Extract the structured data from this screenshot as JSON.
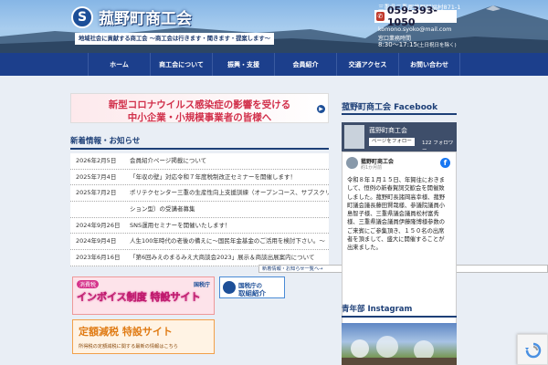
{
  "header": {
    "logo_mark": "S",
    "title": "菰野町商工会",
    "tagline": "地域社会に貢献する商工会 〜商工会は行きます・聞きます・提案します〜",
    "address": "三重県三重郡菰野町福村871-1",
    "phone": "059-393-1050",
    "email": "komono.syoko@mail.com",
    "hours_label": "窓口業務時間",
    "hours": "8:30〜17:15",
    "hours_note": "(土日祝日を除く)"
  },
  "nav": {
    "items": [
      "ホーム",
      "商工会について",
      "振興・支援",
      "会員紹介",
      "交通アクセス",
      "お問い合わせ"
    ]
  },
  "banner": {
    "line1": "新型コロナウイルス感染症の影響を受ける",
    "line2": "中小企業・小規模事業者の皆様へ"
  },
  "news": {
    "heading": "新着情報・お知らせ",
    "items": [
      {
        "date": "2026年2月5日",
        "title": "会員紹介ページ掲載について"
      },
      {
        "date": "2025年7月4日",
        "title": "「年収の壁」対応令和７年度税制改正セミナーを開催します！"
      },
      {
        "date": "2025年7月2日",
        "title": "ポリテクセンター三重の生産性向上支援訓練（オープンコース、サブスクリプ"
      },
      {
        "date": "",
        "title": "ション型）の受講者募集"
      },
      {
        "date": "2024年9月26日",
        "title": "SNS運用セミナーを開催いたします！"
      },
      {
        "date": "2024年9月4日",
        "title": "人生100年時代の老後の備えに〜国民年金基金のご活用を検討下さい。〜"
      },
      {
        "date": "2023年6月16日",
        "title": "「第6回みえのまるみえ大商談会2023」展示＆商談出展案内について"
      }
    ],
    "more": "新着情報・お知らせ一覧へ→"
  },
  "promo": {
    "invoice_pill": "消費税",
    "invoice_text": "インボイス制度 特設サイト",
    "invoice_tax_office": "国税庁",
    "nta_line1": "国税庁の",
    "nta_line2": "取組紹介",
    "deduction_title": "定額減税 特設サイト",
    "deduction_sub": "所得税の定額減税に関する最新の情報はこちら"
  },
  "sidebar": {
    "facebook_heading": "菰野町商工会 Facebook",
    "fb_page_name": "菰野町商工会",
    "fb_follow": "ページをフォロー",
    "fb_followers": "122 フォロワー",
    "fb_post_name": "菰野町商工会",
    "fb_post_date": "約1か月前",
    "fb_logo": "f",
    "fb_post_text": "令和８年１月１５日、年賀往におきまして、恒例の新春賀詞交歓会を開催致しました。菰野町長諸岡高幸様、菰野町議会議長藤田賢哉様、参議院議員小島智子様、三重県議会議員松村富秀様、三重県議会議員伊藤隆博様参数のご来賓にご参集頂き、１５０名の出席者を頂まして、盛大に開催することが出来ました。",
    "instagram_heading": "青年部 Instagram"
  },
  "colors": {
    "nav_bg": "#1c3f8c",
    "accent_red": "#d12f4a",
    "heading_blue": "#1d3f77",
    "facebook_blue": "#1877f2"
  }
}
